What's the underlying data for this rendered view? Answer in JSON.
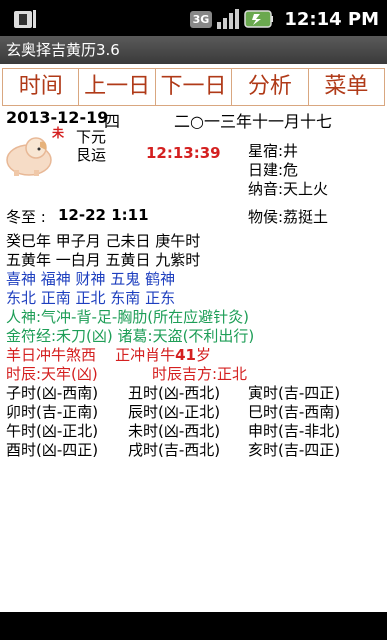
{
  "status": {
    "time": "12:14 PM",
    "network": "3G",
    "icons": [
      "notification-icon",
      "signal-icon",
      "battery-icon"
    ]
  },
  "app": {
    "title": "玄奥择吉黄历3.6"
  },
  "toolbar": {
    "today": "时间",
    "prev": "上一日",
    "next": "下一日",
    "analyze": "分析",
    "menu": "菜单"
  },
  "date": {
    "solar": "2013-12-19",
    "weekday": "四",
    "lunar": "二○一三年十一月十七",
    "zodiac_char": "未",
    "yuan": "下元",
    "yun": "艮运",
    "clock": "12:13:39",
    "xingxiu": "星宿:井",
    "rijian": "日建:危",
    "nayin": "纳音:天上火",
    "jieqi_label": "冬至 :",
    "jieqi_time": "12-22 1:11",
    "wuhou": "物侯:荔挺土"
  },
  "lines": {
    "ganzhi": "癸巳年 甲子月 己未日 庚午时",
    "huang": "五黄年 一白月 五黄日 九紫时",
    "gods": "喜神 福神 财神 五鬼 鹤神",
    "dirs": "东北 正南 正北 东南 正东",
    "renshen": "人神:气冲-背-足-胸肋(所在应避针灸)",
    "jinfu": "金符经:禾刀(凶) 诸葛:天盗(不利出行)",
    "chong_prefix": "羊日冲牛煞西    正冲肖牛",
    "chong_age": "41",
    "chong_suffix": "岁",
    "shichen_left": "时辰:天牢(凶)",
    "shichen_right": "时辰吉方:正北"
  },
  "hours": [
    [
      "子时(凶-西南)",
      "丑时(凶-西北)",
      "寅时(吉-四正)"
    ],
    [
      "卯时(吉-正南)",
      "辰时(凶-正北)",
      "巳时(吉-西南)"
    ],
    [
      "午时(凶-正北)",
      "未时(凶-西北)",
      "申时(吉-非北)"
    ],
    [
      "酉时(凶-四正)",
      "戌时(吉-西北)",
      "亥时(吉-四正)"
    ]
  ]
}
